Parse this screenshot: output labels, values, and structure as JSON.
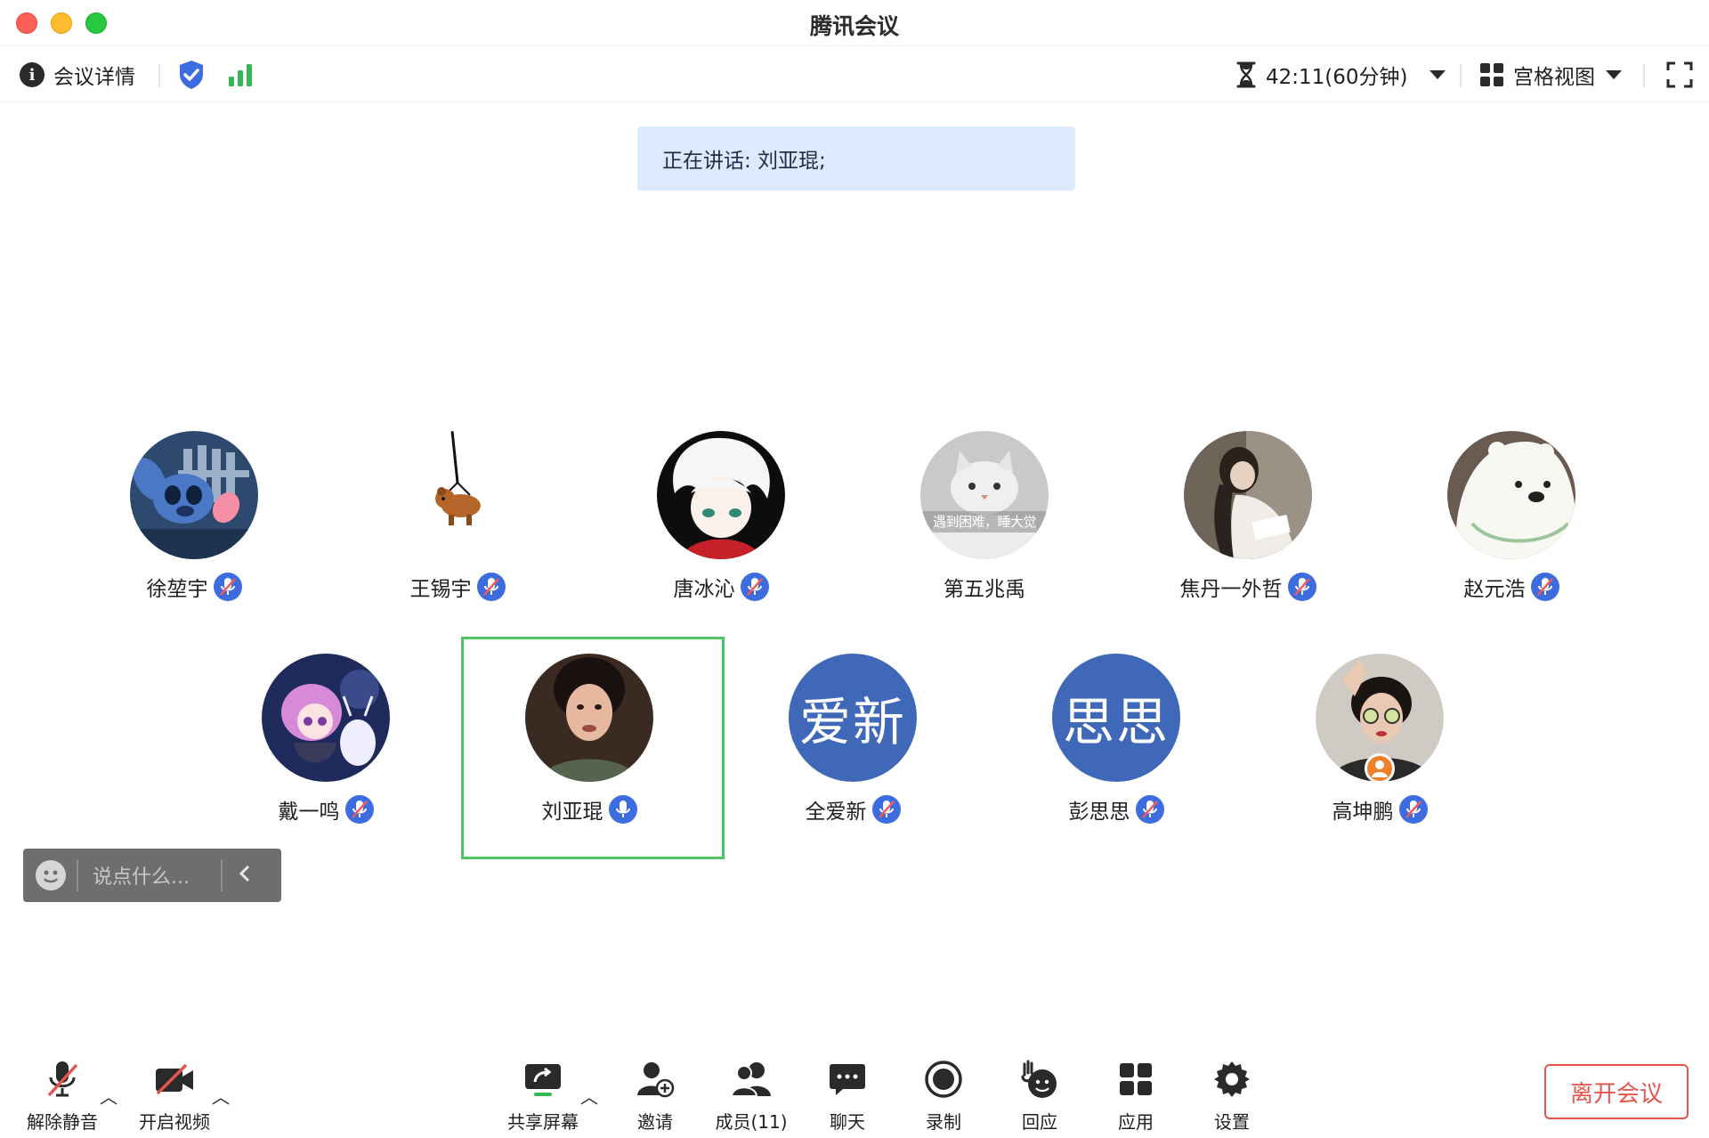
{
  "window": {
    "title": "腾讯会议"
  },
  "toolbar": {
    "details_label": "会议详情",
    "timer": "42:11(60分钟)",
    "view_label": "宫格视图"
  },
  "speaking": {
    "text": "正在讲话: 刘亚琨;"
  },
  "participants": [
    {
      "name": "徐堃宇",
      "avatar": "stitch-cartoon"
    },
    {
      "name": "王锡宇",
      "avatar": "hanging-bear"
    },
    {
      "name": "唐冰沁",
      "avatar": "white-hair-anime"
    },
    {
      "name": "第五兆禹",
      "avatar": "white-cat",
      "avatar_caption": "遇到困难，睡大觉"
    },
    {
      "name": "焦丹一外哲",
      "avatar": "reading-woman"
    },
    {
      "name": "赵元浩",
      "avatar": "ice-bear"
    },
    {
      "name": "戴一鸣",
      "avatar": "anime-girl-deer"
    },
    {
      "name": "刘亚琨",
      "avatar": "woman-portrait",
      "speaking": true
    },
    {
      "name": "全爱新",
      "avatar_text": "爱新"
    },
    {
      "name": "彭思思",
      "avatar_text": "思思"
    },
    {
      "name": "高坤鹏",
      "avatar": "sunglasses-man",
      "host": true
    }
  ],
  "chat": {
    "placeholder": "说点什么..."
  },
  "bottom": {
    "unmute": "解除静音",
    "video": "开启视频",
    "share": "共享屏幕",
    "invite": "邀请",
    "members": "成员(11)",
    "chat": "聊天",
    "record": "录制",
    "react": "回应",
    "apps": "应用",
    "settings": "设置",
    "leave": "离开会议"
  },
  "colors": {
    "accent_blue": "#3d6ce0",
    "speaking_bg": "#dde9fc",
    "active_border": "#4ec463",
    "leave_red": "#e5544d",
    "signal_green": "#34b854"
  }
}
